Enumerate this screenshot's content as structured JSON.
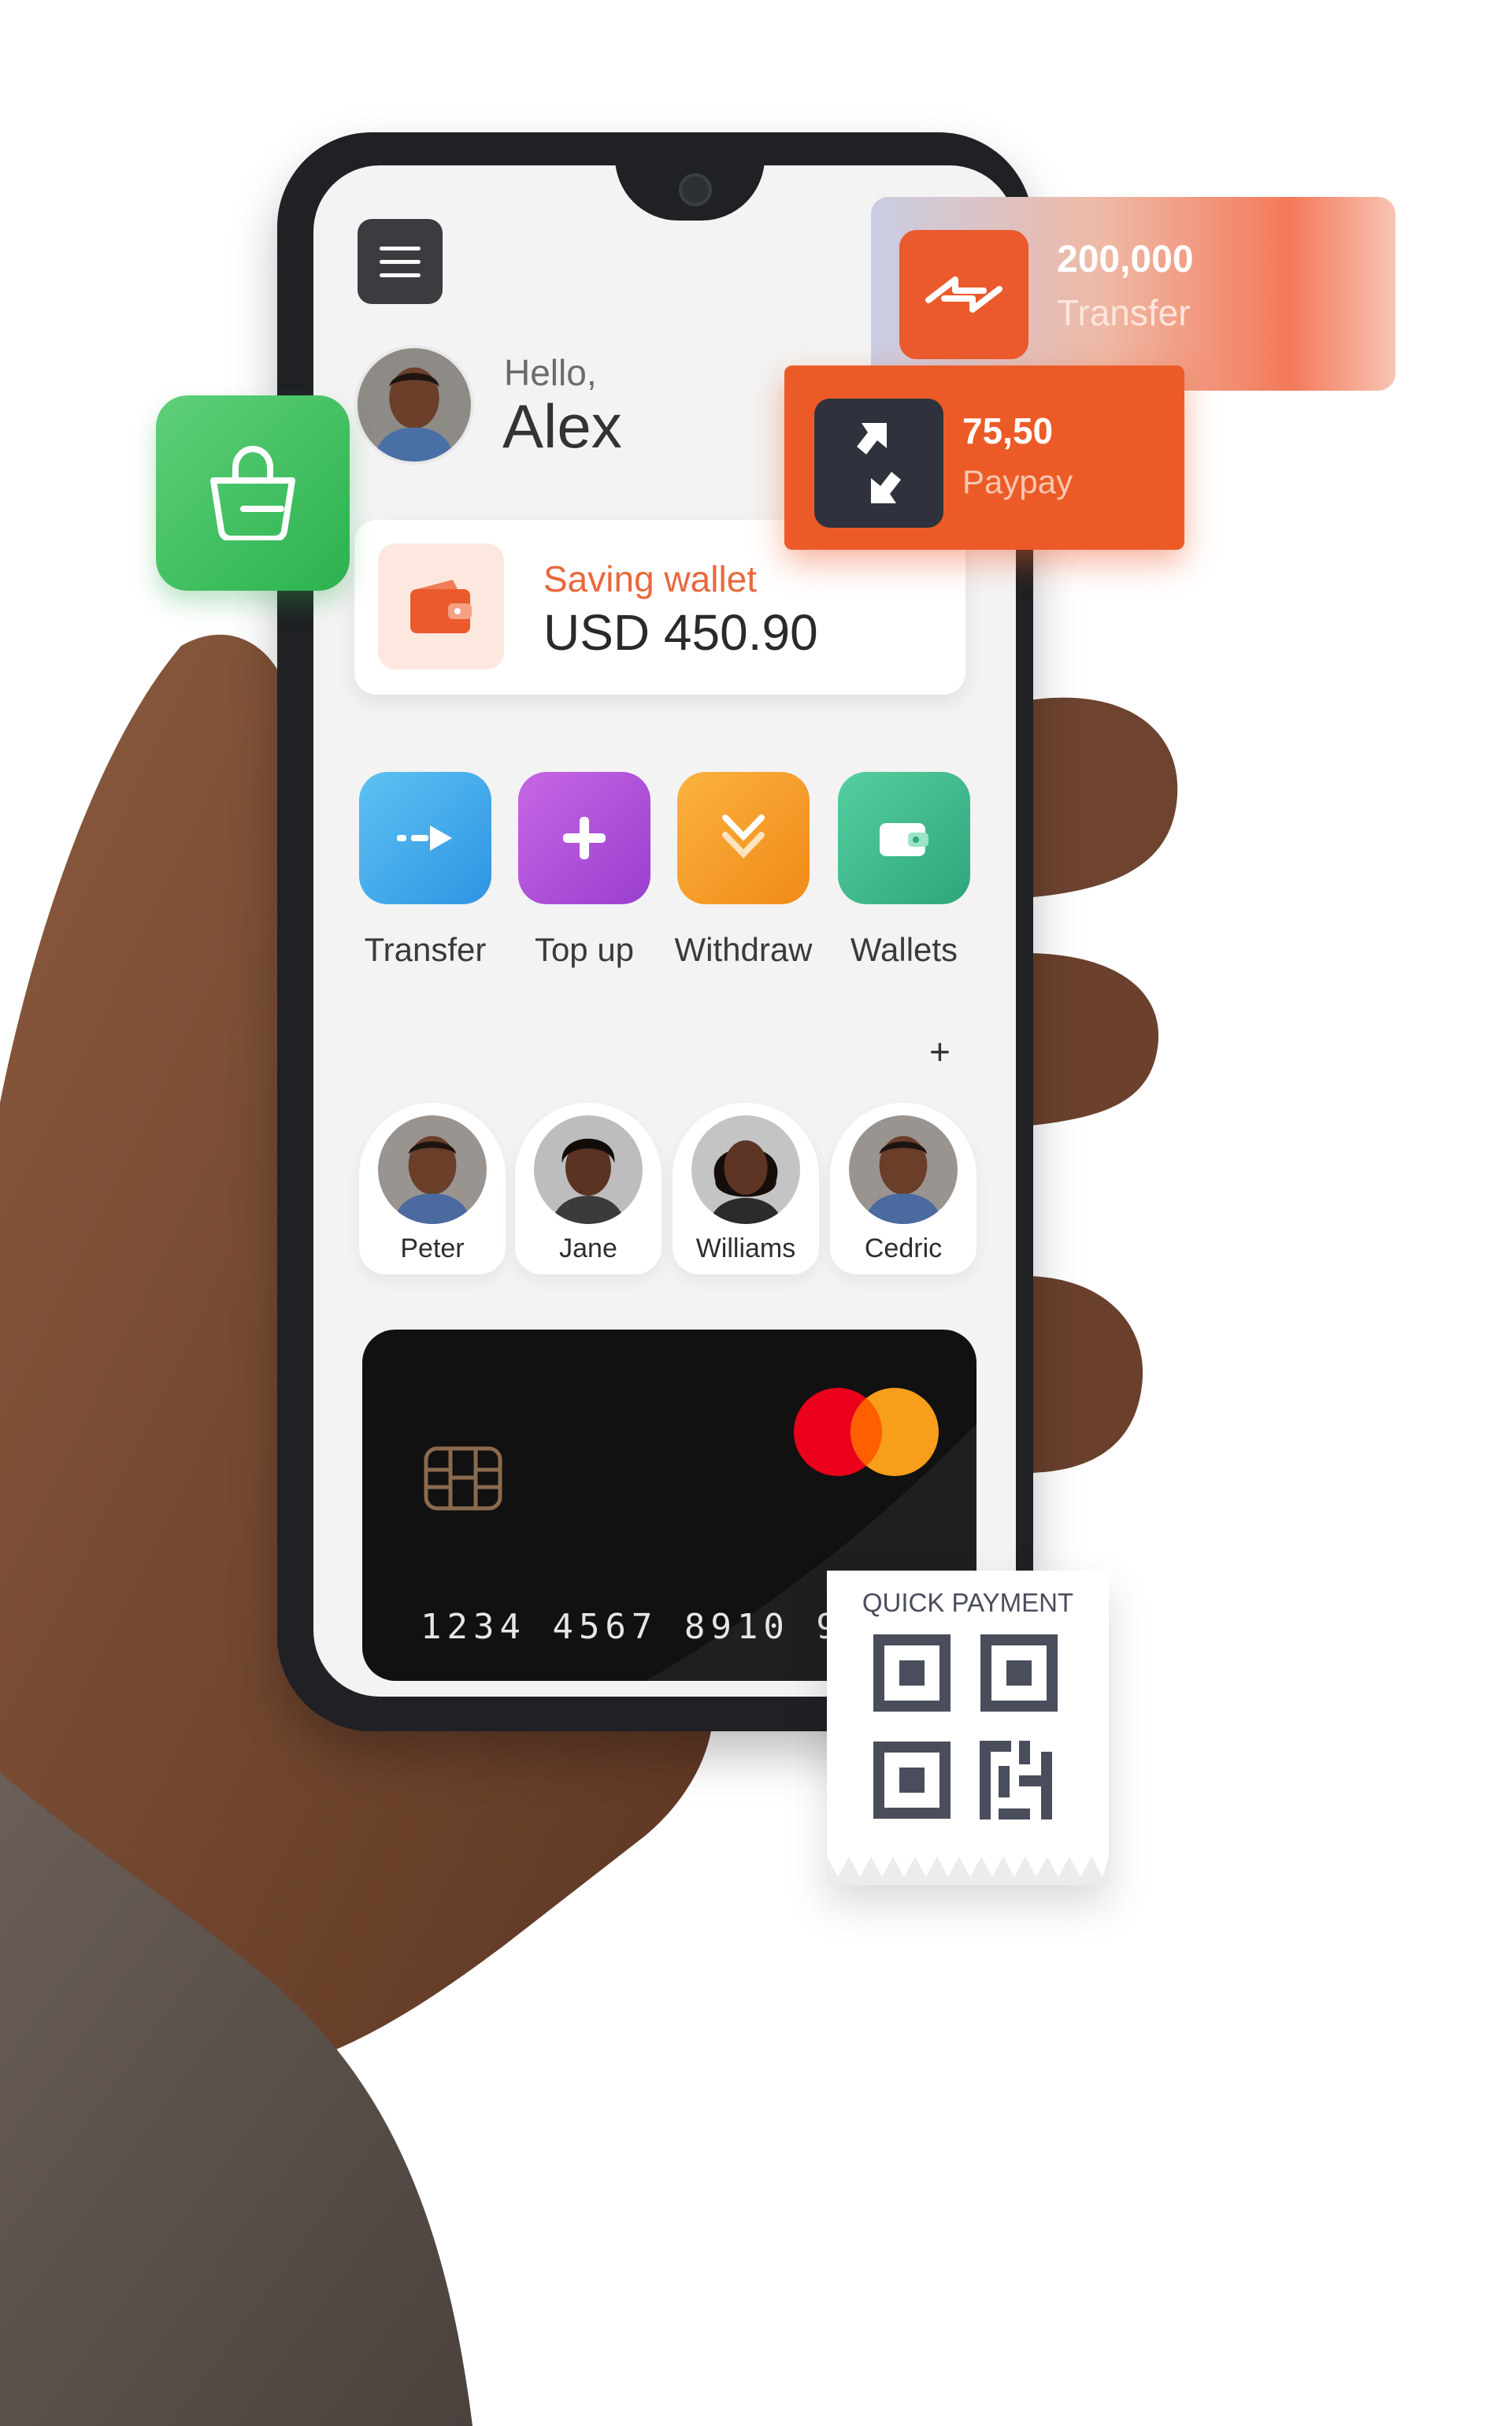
{
  "greeting": {
    "hello": "Hello,",
    "name": "Alex"
  },
  "wallet": {
    "label": "Saving wallet",
    "amount": "USD 450.90",
    "icon": "wallet-icon"
  },
  "actions": [
    {
      "label": "Transfer",
      "icon": "transfer-arrow-icon",
      "color": "#3da9ea"
    },
    {
      "label": "Top up",
      "icon": "plus-icon",
      "color": "#b050d6"
    },
    {
      "label": "Withdraw",
      "icon": "withdraw-icon",
      "color": "#f59a25"
    },
    {
      "label": "Wallets",
      "icon": "wallet-icon",
      "color": "#3fb98a"
    }
  ],
  "contacts": {
    "add_label": "+",
    "items": [
      {
        "name": "Peter"
      },
      {
        "name": "Jane"
      },
      {
        "name": "Williams"
      },
      {
        "name": "Cedric"
      }
    ]
  },
  "card": {
    "number": "1234  4567  8910  9",
    "brand": "mastercard-logo"
  },
  "floating": {
    "transfer": {
      "amount": "200,000",
      "label": "Transfer"
    },
    "paypay": {
      "amount": "75,50",
      "label": "Paypay"
    },
    "shopping_icon": "shopping-bag-icon",
    "quick_payment": {
      "title": "QUICK PAYMENT",
      "icon": "qr-code-icon"
    }
  },
  "colors": {
    "accent_orange": "#ea5a2d",
    "shop_green": "#3cc25e",
    "card_black": "#111111"
  }
}
